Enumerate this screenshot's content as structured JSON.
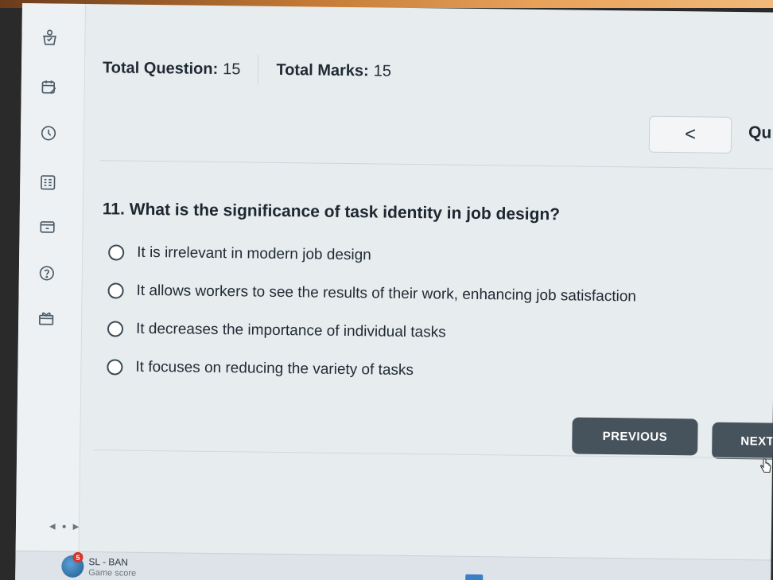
{
  "header": {
    "total_question_label": "Total Question:",
    "total_question_value": "15",
    "total_marks_label": "Total Marks:",
    "total_marks_value": "15"
  },
  "nav": {
    "prev_glyph": "<",
    "question_label": "Qu"
  },
  "question": {
    "text": "11. What is the significance of task identity in job design?",
    "options": [
      "It is irrelevant in modern job design",
      "It allows workers to see the results of their work, enhancing job satisfaction",
      "It decreases the importance of individual tasks",
      "It focuses on reducing the variety of tasks"
    ]
  },
  "buttons": {
    "previous": "PREVIOUS",
    "next": "NEXT"
  },
  "taskbar": {
    "badge_count": "5",
    "widget_title": "SL - BAN",
    "widget_subtitle": "Game score"
  },
  "colors": {
    "button_bg": "#46535d",
    "screen_bg": "#e7ecef",
    "badge_red": "#d8362b"
  }
}
